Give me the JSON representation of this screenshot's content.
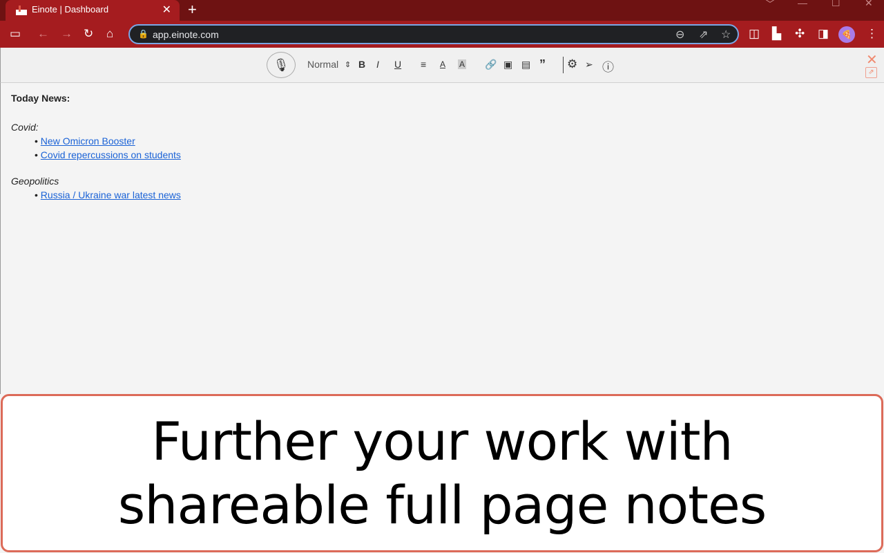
{
  "browser": {
    "tab_title": "Einote | Dashboard",
    "url": "app.einote.com"
  },
  "editor": {
    "format_select": "Normal"
  },
  "note": {
    "heading": "Today News:",
    "sections": [
      {
        "title": "Covid:",
        "links": [
          "New Omicron Booster",
          "Covid repercussions on students"
        ]
      },
      {
        "title": "Geopolitics",
        "links": [
          "Russia / Ukraine war latest news"
        ]
      }
    ]
  },
  "banner": {
    "line1": "Further your work with",
    "line2": "shareable full page notes"
  },
  "colors": {
    "browser_frame": "#a51c1f",
    "banner_border": "#dc6a58",
    "link": "#1a62d6"
  }
}
